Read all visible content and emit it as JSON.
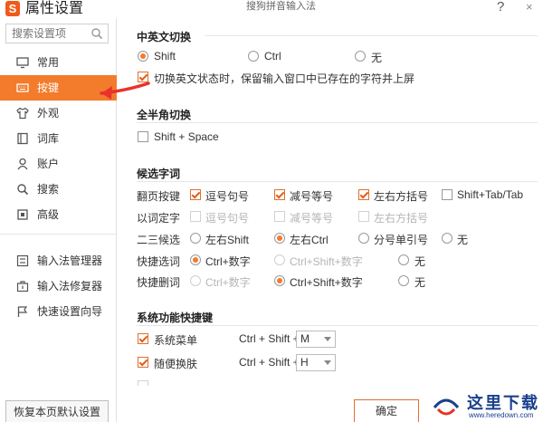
{
  "window": {
    "title": "属性设置",
    "subtitle": "搜狗拼音输入法",
    "help": "?",
    "close": "×"
  },
  "sidebar": {
    "search_placeholder": "搜索设置项",
    "items": [
      {
        "label": "常用",
        "icon": "monitor-icon"
      },
      {
        "label": "按键",
        "icon": "keyboard-icon",
        "active": true
      },
      {
        "label": "外观",
        "icon": "shirt-icon"
      },
      {
        "label": "词库",
        "icon": "book-icon"
      },
      {
        "label": "账户",
        "icon": "user-icon"
      },
      {
        "label": "搜索",
        "icon": "search-icon"
      },
      {
        "label": "高级",
        "icon": "advanced-icon"
      }
    ],
    "tools": [
      {
        "label": "输入法管理器",
        "icon": "list-icon"
      },
      {
        "label": "输入法修复器",
        "icon": "toolbox-icon"
      },
      {
        "label": "快速设置向导",
        "icon": "flag-icon"
      }
    ],
    "restore_label": "恢复本页默认设置"
  },
  "main": {
    "cn_en_switch": {
      "title": "中英文切换",
      "options": [
        "Shift",
        "Ctrl",
        "无"
      ],
      "selected": "Shift",
      "keep_chars_label": "切换英文状态时，保留输入窗口中已存在的字符并上屏",
      "keep_chars_checked": true
    },
    "full_half": {
      "title": "全半角切换",
      "option_label": "Shift + Space",
      "checked": false
    },
    "candidate": {
      "title": "候选字词",
      "page_label": "翻页按键",
      "page_options": [
        {
          "label": "逗号句号",
          "checked": true
        },
        {
          "label": "减号等号",
          "checked": true
        },
        {
          "label": "左右方括号",
          "checked": true
        },
        {
          "label": "Shift+Tab/Tab",
          "checked": false
        }
      ],
      "word_label": "以词定字",
      "word_options": [
        "逗号句号",
        "减号等号",
        "左右方括号"
      ],
      "second_label": "二三候选",
      "second_options": [
        "左右Shift",
        "左右Ctrl",
        "分号单引号",
        "无"
      ],
      "second_selected": "左右Ctrl",
      "quick_select_label": "快捷选词",
      "quick_select_options": [
        "Ctrl+数字",
        "Ctrl+Shift+数字",
        "无"
      ],
      "quick_delete_label": "快捷删词",
      "quick_delete_options": [
        "Ctrl+数字",
        "Ctrl+Shift+数字",
        "无"
      ]
    },
    "system": {
      "title": "系统功能快捷键",
      "rows": [
        {
          "label": "系统菜单",
          "checked": true,
          "combo": "Ctrl + Shift +",
          "key": "M"
        },
        {
          "label": "随便换肤",
          "checked": true,
          "combo": "Ctrl + Shift +",
          "key": "H"
        }
      ]
    },
    "ok_label": "确定"
  },
  "watermark": {
    "text": "这里下载",
    "url": "www.heredown.com"
  },
  "colors": {
    "accent": "#f37b2c",
    "arrow": "#e8322a"
  }
}
